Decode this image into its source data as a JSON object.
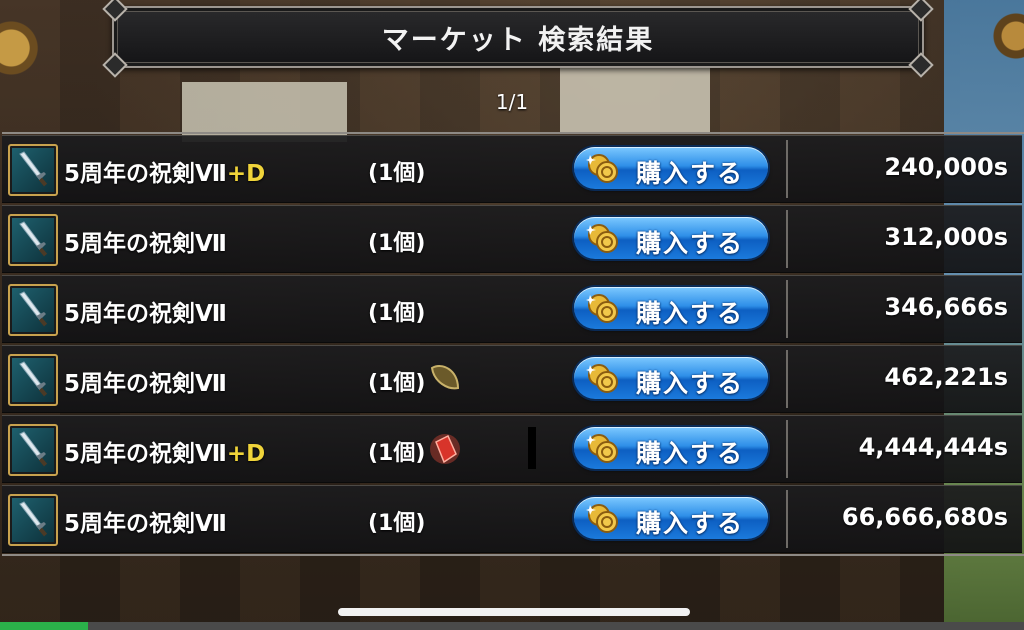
{
  "title": "マーケット 検索結果",
  "page_counter": "1/1",
  "buy_label": "購入する",
  "rows": [
    {
      "name": "5周年の祝剣Ⅶ",
      "plus": "+D",
      "qty": "(1個)",
      "status_icon": "",
      "price": "240,000s"
    },
    {
      "name": "5周年の祝剣Ⅶ",
      "plus": "",
      "qty": "(1個)",
      "status_icon": "",
      "price": "312,000s"
    },
    {
      "name": "5周年の祝剣Ⅶ",
      "plus": "",
      "qty": "(1個)",
      "status_icon": "",
      "price": "346,666s"
    },
    {
      "name": "5周年の祝剣Ⅶ",
      "plus": "",
      "qty": "(1個)",
      "status_icon": "seed-icon",
      "price": "462,221s"
    },
    {
      "name": "5周年の祝剣Ⅶ",
      "plus": "+D",
      "qty": "(1個)",
      "status_icon": "red-crystal-icon",
      "price": "4,444,444s"
    },
    {
      "name": "5周年の祝剣Ⅶ",
      "plus": "",
      "qty": "(1個)",
      "status_icon": "",
      "price": "66,666,680s"
    }
  ],
  "colors": {
    "plus_text": "#f0d43a",
    "buy_button": "#2e8fe8",
    "frame_gold": "#c8a24e"
  },
  "item_icon": "sword-icon",
  "buy_icon": "gold-coin-icon"
}
